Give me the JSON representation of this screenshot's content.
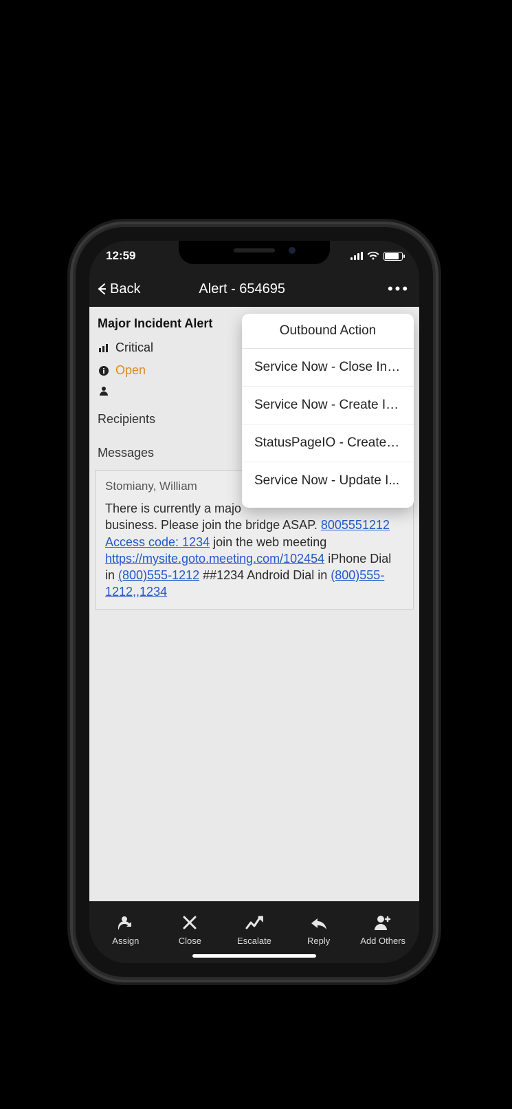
{
  "status_bar": {
    "time": "12:59"
  },
  "nav": {
    "back_label": "Back",
    "title": "Alert - 654695"
  },
  "alert": {
    "title": "Major Incident Alert",
    "severity": "Critical",
    "state": "Open",
    "state_color": "#e08a1f",
    "recipients_label": "Recipients",
    "messages_label": "Messages"
  },
  "dropdown": {
    "title": "Outbound Action",
    "items": [
      "Service Now - Close Inc...",
      "Service Now - Create In...",
      "StatusPageIO - Create I...",
      "Service Now - Update I..."
    ]
  },
  "message": {
    "author": "Stomiany, William",
    "body_prefix": "There is currently a majo",
    "body_mid1": "business. Please join the bridge ASAP. ",
    "link1": "8005551212 Access code: 1234",
    "body_mid2": "  join the web meeting ",
    "link2": "https://mysite.goto.meeting.com/102454",
    "body_mid3": "  iPhone Dial in ",
    "link3": "(800)555-1212",
    "body_mid4": " ##1234  Android Dial in ",
    "link4": "(800)555-1212,,1234"
  },
  "actions": {
    "assign": "Assign",
    "close": "Close",
    "escalate": "Escalate",
    "reply": "Reply",
    "add_others": "Add Others"
  }
}
